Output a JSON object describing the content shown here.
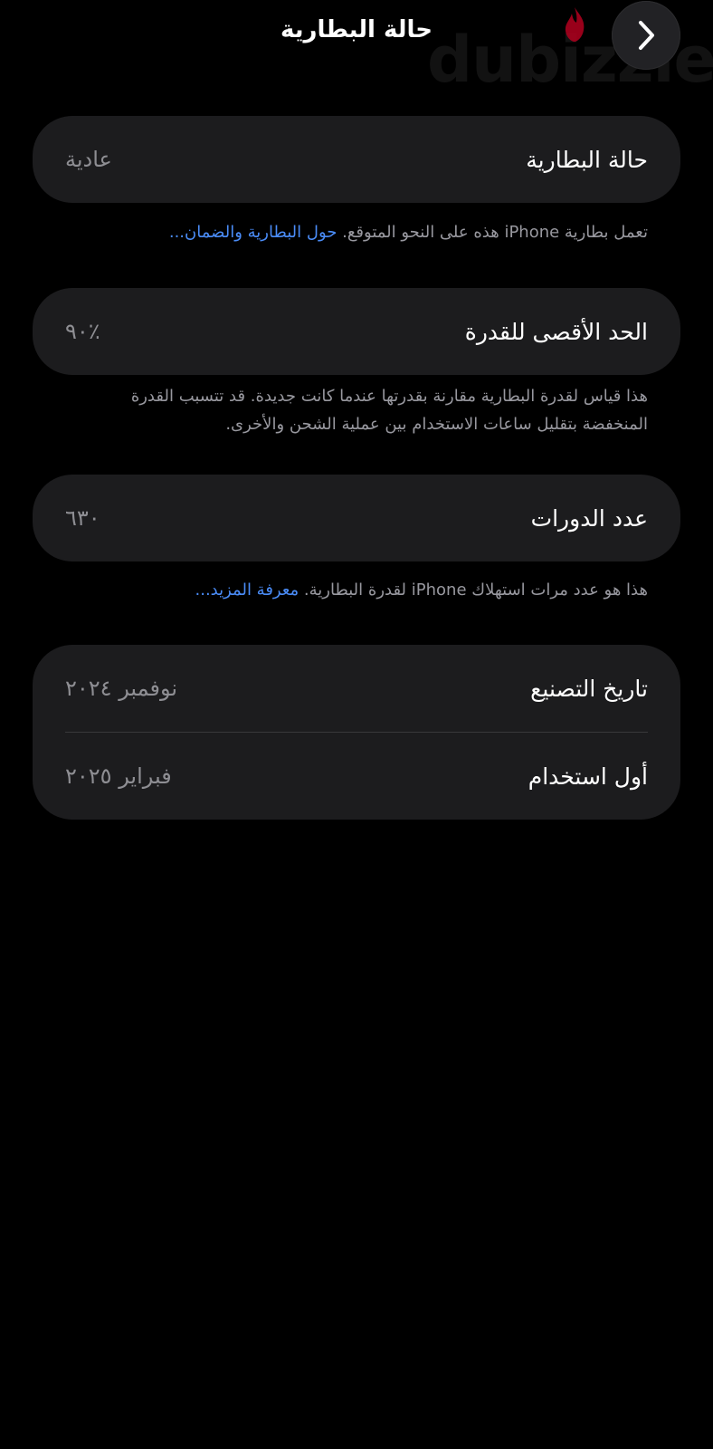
{
  "header": {
    "title": "حالة البطارية",
    "back_icon": "chevron-icon"
  },
  "watermark": {
    "text": "dubizzle",
    "flame_color": "#e4002b"
  },
  "status_card": {
    "label": "حالة البطارية",
    "value": "عادية"
  },
  "status_note": {
    "text": "تعمل بطارية iPhone هذه على النحو المتوقع.",
    "link": "حول البطارية والضمان..."
  },
  "capacity_card": {
    "label": "الحد الأقصى للقدرة",
    "value": "٪٩٠"
  },
  "capacity_note": {
    "text": "هذا قياس لقدرة البطارية مقارنة بقدرتها عندما كانت جديدة. قد تتسبب القدرة المنخفضة بتقليل ساعات الاستخدام بين عملية الشحن والأخرى."
  },
  "cycles_card": {
    "label": "عدد الدورات",
    "value": "٦٣٠"
  },
  "cycles_note": {
    "text": "هذا هو عدد مرات استهلاك iPhone لقدرة البطارية.",
    "link": "معرفة المزيد..."
  },
  "dates_card": {
    "manufacture_label": "تاريخ التصنيع",
    "manufacture_value": "نوفمبر ٢٠٢٤",
    "first_use_label": "أول استخدام",
    "first_use_value": "فبراير ٢٠٢٥"
  },
  "colors": {
    "background": "#000000",
    "card": "#1c1c1e",
    "link": "#4a8cf7",
    "secondary_text": "#8e8e93"
  }
}
